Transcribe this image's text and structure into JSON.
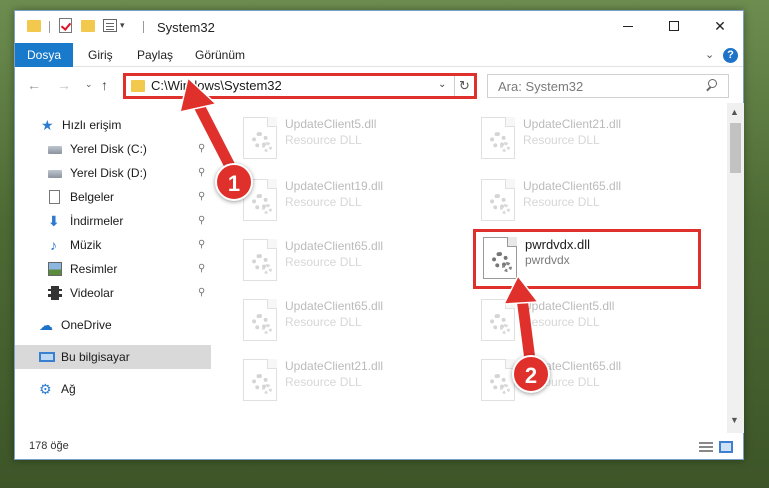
{
  "window": {
    "title": "System32",
    "controls": {
      "minimize": "",
      "maximize": "",
      "close": "✕"
    }
  },
  "ribbon": {
    "tabs": [
      "Dosya",
      "Giriş",
      "Paylaş",
      "Görünüm"
    ],
    "expand_glyph": "⌄",
    "help_glyph": "?"
  },
  "navigation": {
    "back_glyph": "←",
    "forward_glyph": "→",
    "recent_glyph": "⌄",
    "up_glyph": "↑",
    "address": "C:\\Windows\\System32",
    "address_drop_glyph": "⌄",
    "refresh_glyph": "↻",
    "search_placeholder": "Ara: System32"
  },
  "sidebar": {
    "items": [
      {
        "label": "Hızlı erişim",
        "icon": "star-icon",
        "glyph": "★",
        "pinned": false
      },
      {
        "label": "Yerel Disk (C:)",
        "icon": "drive-icon",
        "glyph": "",
        "pinned": true
      },
      {
        "label": "Yerel Disk (D:)",
        "icon": "drive-icon",
        "glyph": "",
        "pinned": true
      },
      {
        "label": "Belgeler",
        "icon": "document-icon",
        "glyph": "",
        "pinned": true
      },
      {
        "label": "İndirmeler",
        "icon": "download-icon",
        "glyph": "⬇",
        "pinned": true
      },
      {
        "label": "Müzik",
        "icon": "music-icon",
        "glyph": "♪",
        "pinned": true
      },
      {
        "label": "Resimler",
        "icon": "pictures-icon",
        "glyph": "",
        "pinned": true
      },
      {
        "label": "Videolar",
        "icon": "video-icon",
        "glyph": "",
        "pinned": true
      },
      {
        "label": "OneDrive",
        "icon": "cloud-icon",
        "glyph": "☁",
        "pinned": false
      },
      {
        "label": "Bu bilgisayar",
        "icon": "computer-icon",
        "glyph": "",
        "pinned": false,
        "selected": true
      },
      {
        "label": "Ağ",
        "icon": "network-icon",
        "glyph": "⚙",
        "pinned": false
      }
    ],
    "pin_glyph": "📌"
  },
  "files": [
    {
      "name": "UpdateClient5.dll",
      "description": "Resource DLL",
      "selected": false
    },
    {
      "name": "UpdateClient21.dll",
      "description": "Resource DLL",
      "selected": false
    },
    {
      "name": "UpdateClient19.dll",
      "description": "Resource DLL",
      "selected": false
    },
    {
      "name": "UpdateClient65.dll",
      "description": "Resource DLL",
      "selected": false
    },
    {
      "name": "UpdateClient65.dll",
      "description": "Resource DLL",
      "selected": false
    },
    {
      "name": "pwrdvdx.dll",
      "description": "pwrdvdx",
      "selected": true
    },
    {
      "name": "UpdateClient65.dll",
      "description": "Resource DLL",
      "selected": false
    },
    {
      "name": "UpdateClient5.dll",
      "description": "Resource DLL",
      "selected": false
    },
    {
      "name": "UpdateClient21.dll",
      "description": "Resource DLL",
      "selected": false
    },
    {
      "name": "UpdateClient65.dll",
      "description": "Resource DLL",
      "selected": false
    }
  ],
  "scrollbar": {
    "up_glyph": "▲",
    "down_glyph": "▼"
  },
  "status": {
    "item_count": "178 öğe"
  },
  "callouts": [
    {
      "number": "1"
    },
    {
      "number": "2"
    }
  ],
  "colors": {
    "accent": "#1979ca",
    "highlight_red": "#e0302c",
    "folder_yellow": "#f2c94c"
  }
}
